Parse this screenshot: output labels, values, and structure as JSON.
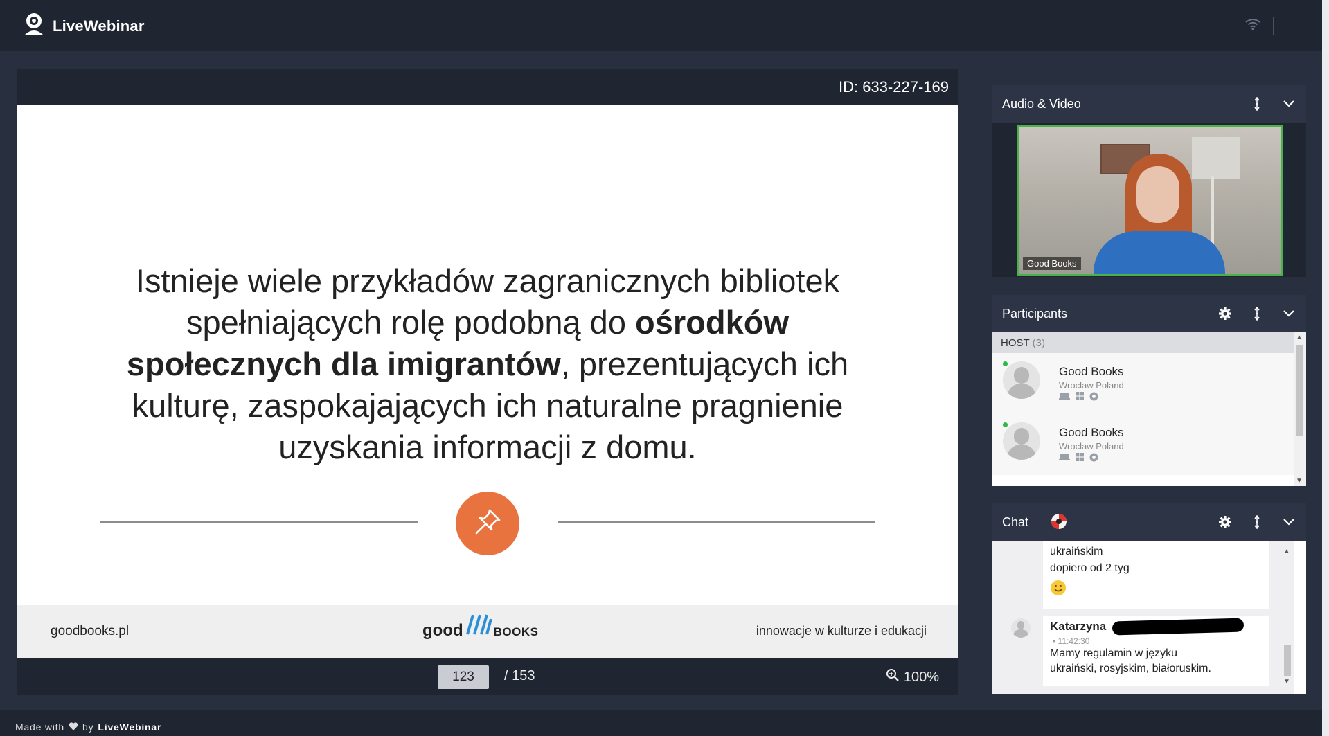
{
  "app": {
    "logo_text": "LiveWebinar"
  },
  "presentation": {
    "id_text": "ID: 633-227-169",
    "slide": {
      "line1": "Istnieje wiele przykładów zagranicznych bibliotek",
      "line2_normal": "spełniających rolę podobną do ",
      "line2_bold": "ośrodków",
      "line3_bold": "społecznych dla imigrantów",
      "line3_normal": ", prezentujących ich",
      "line4": "kulturę, zaspokajających ich naturalne pragnienie",
      "line5": "uzyskania informacji z domu.",
      "footer_left": "goodbooks.pl",
      "footer_logo_left": "good",
      "footer_logo_right": "books",
      "footer_right": "innowacje w kulturze i edukacji",
      "accent_color": "#e9733f"
    },
    "controls": {
      "current_page": "123",
      "total_pages": "/ 153",
      "zoom": "100%"
    }
  },
  "audio_video": {
    "title": "Audio & Video",
    "video_label": "Good Books"
  },
  "participants": {
    "title": "Participants",
    "host_label": "HOST",
    "host_count": "(3)",
    "items": [
      {
        "name": "Good Books",
        "location": "Wroclaw Poland",
        "status_color": "#2eb84a"
      },
      {
        "name": "Good Books",
        "location": "Wroclaw Poland",
        "status_color": "#2eb84a"
      }
    ]
  },
  "chat": {
    "title": "Chat",
    "messages": [
      {
        "line1": "ukraińskim",
        "line2": "dopiero od  2 tyg"
      },
      {
        "author": "Katarzyna",
        "time": "• 11:42:30",
        "line1": "Mamy regulamin w języku",
        "line2": "ukraiński, rosyjskim, białoruskim."
      }
    ]
  },
  "footer": {
    "made_with": "Made with",
    "by": "by",
    "brand": "LiveWebinar"
  }
}
